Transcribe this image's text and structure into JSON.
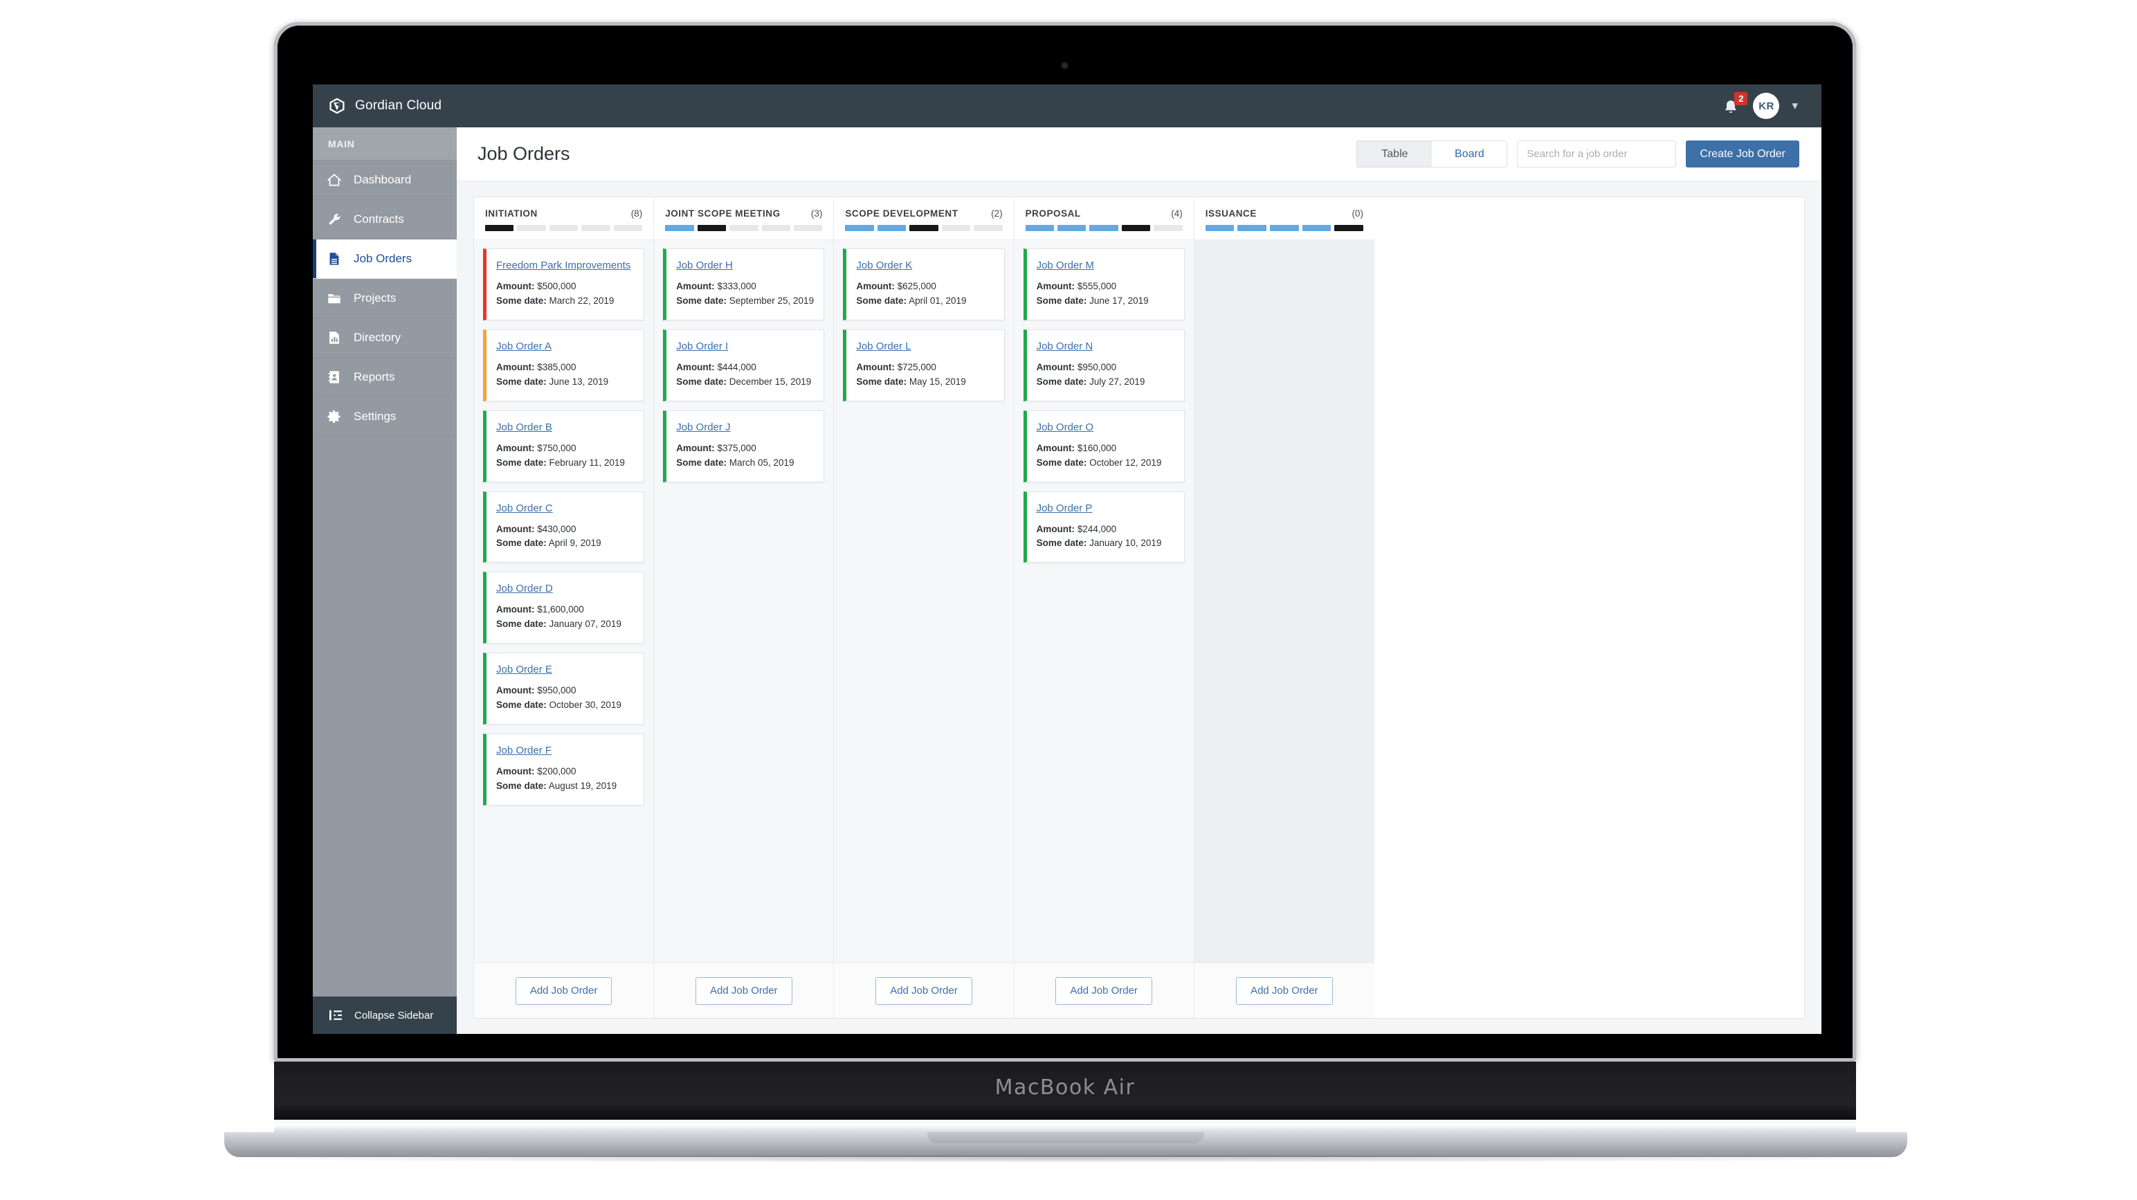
{
  "device": {
    "label": "MacBook Air"
  },
  "topbar": {
    "brand": "Gordian Cloud",
    "notifications_count": "2",
    "avatar_initials": "KR"
  },
  "sidebar": {
    "section_label": "MAIN",
    "items": [
      {
        "label": "Dashboard",
        "icon": "home-icon",
        "active": false
      },
      {
        "label": "Contracts",
        "icon": "wrench-icon",
        "active": false
      },
      {
        "label": "Job Orders",
        "icon": "document-icon",
        "active": true
      },
      {
        "label": "Projects",
        "icon": "folder-icon",
        "active": false
      },
      {
        "label": "Directory",
        "icon": "chart-document-icon",
        "active": false
      },
      {
        "label": "Reports",
        "icon": "contact-book-icon",
        "active": false
      },
      {
        "label": "Settings",
        "icon": "gear-icon",
        "active": false
      }
    ],
    "collapse_label": "Collapse Sidebar"
  },
  "page": {
    "title": "Job Orders",
    "view_toggle": {
      "options": [
        "Table",
        "Board"
      ],
      "selected": "Board"
    },
    "search_placeholder": "Search for a job order",
    "search_value": "",
    "create_label": "Create Job Order",
    "add_label": "Add Job Order"
  },
  "colors": {
    "accent_blue": "#3d6fa8",
    "progress_blue": "#63a8e2",
    "progress_current": "#16181a",
    "progress_empty": "#e6e9ec",
    "status_red": "#e8362a",
    "status_orange": "#f3a33a",
    "status_green": "#1faa4b",
    "topbar_dark": "#35424c",
    "sidebar_gray": "#949aa1"
  },
  "board": {
    "columns": [
      {
        "title": "INITIATION",
        "count": "(8)",
        "progress": [
          "black",
          "empty",
          "empty",
          "empty",
          "empty"
        ],
        "cards": [
          {
            "title": "Freedom Park Improvements",
            "amount_label": "Amount:",
            "amount": "$500,000",
            "date_label": "Some date:",
            "date": "March 22, 2019",
            "status": "red"
          },
          {
            "title": "Job Order A",
            "amount_label": "Amount:",
            "amount": "$385,000",
            "date_label": "Some date:",
            "date": "June 13, 2019",
            "status": "orange"
          },
          {
            "title": "Job Order B",
            "amount_label": "Amount:",
            "amount": "$750,000",
            "date_label": "Some date:",
            "date": "February 11, 2019",
            "status": "green"
          },
          {
            "title": "Job Order C",
            "amount_label": "Amount:",
            "amount": "$430,000",
            "date_label": "Some date:",
            "date": "April 9, 2019",
            "status": "green"
          },
          {
            "title": "Job Order D",
            "amount_label": "Amount:",
            "amount": "$1,600,000",
            "date_label": "Some date:",
            "date": "January 07, 2019",
            "status": "green"
          },
          {
            "title": "Job Order E",
            "amount_label": "Amount:",
            "amount": "$950,000",
            "date_label": "Some date:",
            "date": "October 30, 2019",
            "status": "green"
          },
          {
            "title": "Job Order F",
            "amount_label": "Amount:",
            "amount": "$200,000",
            "date_label": "Some date:",
            "date": "August 19, 2019",
            "status": "green"
          }
        ]
      },
      {
        "title": "JOINT SCOPE MEETING",
        "count": "(3)",
        "progress": [
          "blue",
          "black",
          "empty",
          "empty",
          "empty"
        ],
        "cards": [
          {
            "title": "Job Order H",
            "amount_label": "Amount:",
            "amount": "$333,000",
            "date_label": "Some date:",
            "date": "September 25, 2019",
            "status": "green"
          },
          {
            "title": "Job Order I",
            "amount_label": "Amount:",
            "amount": "$444,000",
            "date_label": "Some date:",
            "date": "December 15, 2019",
            "status": "green"
          },
          {
            "title": "Job Order J",
            "amount_label": "Amount:",
            "amount": "$375,000",
            "date_label": "Some date:",
            "date": "March 05, 2019",
            "status": "green"
          }
        ]
      },
      {
        "title": "SCOPE DEVELOPMENT",
        "count": "(2)",
        "progress": [
          "blue",
          "blue",
          "black",
          "empty",
          "empty"
        ],
        "cards": [
          {
            "title": "Job Order K",
            "amount_label": "Amount:",
            "amount": "$625,000",
            "date_label": "Some date:",
            "date": "April 01, 2019",
            "status": "green"
          },
          {
            "title": "Job Order L",
            "amount_label": "Amount:",
            "amount": "$725,000",
            "date_label": "Some date:",
            "date": "May 15, 2019",
            "status": "green"
          }
        ]
      },
      {
        "title": "PROPOSAL",
        "count": "(4)",
        "progress": [
          "blue",
          "blue",
          "blue",
          "black",
          "empty"
        ],
        "cards": [
          {
            "title": "Job Order M",
            "amount_label": "Amount:",
            "amount": "$555,000",
            "date_label": "Some date:",
            "date": "June 17, 2019",
            "status": "green"
          },
          {
            "title": "Job Order N",
            "amount_label": "Amount:",
            "amount": "$950,000",
            "date_label": "Some date:",
            "date": "July 27, 2019",
            "status": "green"
          },
          {
            "title": "Job Order O",
            "amount_label": "Amount:",
            "amount": "$160,000",
            "date_label": "Some date:",
            "date": "October 12, 2019",
            "status": "green"
          },
          {
            "title": "Job Order P",
            "amount_label": "Amount:",
            "amount": "$244,000",
            "date_label": "Some date:",
            "date": "January 10, 2019",
            "status": "green"
          }
        ]
      },
      {
        "title": "ISSUANCE",
        "count": "(0)",
        "progress": [
          "blue",
          "blue",
          "blue",
          "blue",
          "black"
        ],
        "cards": []
      }
    ]
  }
}
